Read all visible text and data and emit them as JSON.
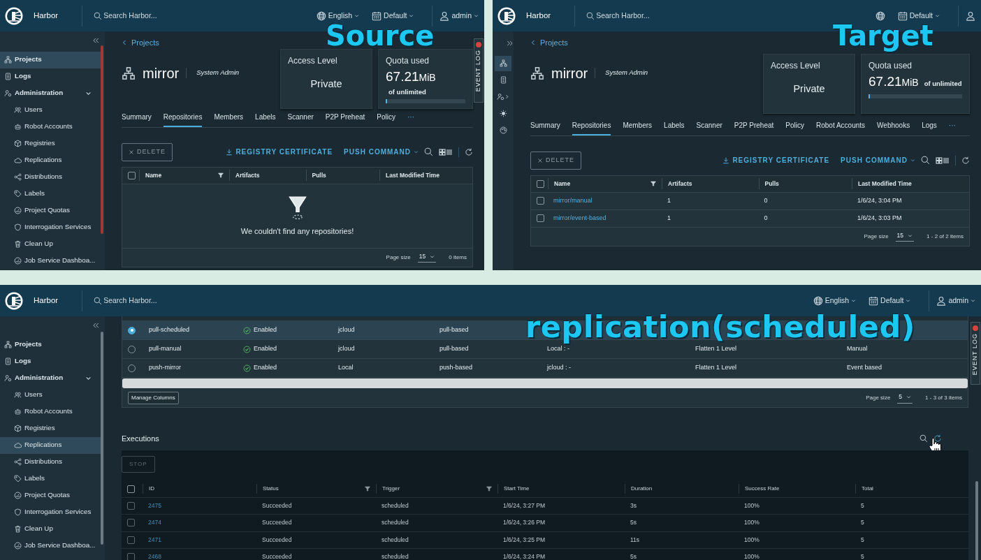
{
  "source": {
    "caption": "Source",
    "header": {
      "brand": "Harbor",
      "search_placeholder": "Search Harbor...",
      "language": "English",
      "theme": "Default",
      "user": "admin"
    },
    "sidebar": {
      "collapsed": false,
      "items": [
        {
          "label": "Projects",
          "selected": true
        },
        {
          "label": "Logs",
          "selected": false
        },
        {
          "label": "Administration",
          "selected": false,
          "expanded": true,
          "children": [
            {
              "label": "Users",
              "selected": false
            },
            {
              "label": "Robot Accounts",
              "selected": false
            },
            {
              "label": "Registries",
              "selected": false
            },
            {
              "label": "Replications",
              "selected": false
            },
            {
              "label": "Distributions",
              "selected": false
            },
            {
              "label": "Labels",
              "selected": false
            },
            {
              "label": "Project Quotas",
              "selected": false
            },
            {
              "label": "Interrogation Services",
              "selected": false
            },
            {
              "label": "Clean Up",
              "selected": false
            },
            {
              "label": "Job Service Dashboa...",
              "selected": false
            }
          ]
        }
      ]
    },
    "event_log": "EVENT LOG",
    "project": {
      "back_link": "Projects",
      "name": "mirror",
      "role": "System Admin",
      "access_card": {
        "title": "Access Level",
        "value": "Private"
      },
      "quota_card": {
        "title": "Quota used",
        "value": "67.21",
        "unit": "MiB",
        "note": "of unlimited",
        "level": 0
      },
      "tabs": [
        {
          "label": "Summary",
          "selected": false
        },
        {
          "label": "Repositories",
          "selected": true
        },
        {
          "label": "Members",
          "selected": false
        },
        {
          "label": "Labels",
          "selected": false
        },
        {
          "label": "Scanner",
          "selected": false
        },
        {
          "label": "P2P Preheat",
          "selected": false
        },
        {
          "label": "Policy",
          "selected": false
        }
      ],
      "more": "···",
      "toolbar": {
        "delete": "DELETE",
        "certificate": "REGISTRY CERTIFICATE",
        "push_command": "PUSH COMMAND"
      },
      "table": {
        "columns": [
          {
            "label": "Name",
            "filter": true
          },
          {
            "label": "Artifacts",
            "filter": false
          },
          {
            "label": "Pulls",
            "filter": false
          },
          {
            "label": "Last Modified Time",
            "filter": false
          }
        ],
        "select_all_checked": false,
        "empty_message": "We couldn't find any repositories!",
        "page_size_label": "Page size",
        "page_size": "15",
        "count": "0 items"
      }
    }
  },
  "target": {
    "caption": "Target",
    "header": {
      "brand": "Harbor",
      "search_placeholder": "Search Harbor...",
      "theme": "Default"
    },
    "sidebar": {
      "collapsed": true,
      "items": [
        {
          "selected": true
        },
        {
          "selected": false
        },
        {
          "selected": false,
          "expanded": false
        },
        {
          "selected": false
        },
        {
          "selected": false
        }
      ]
    },
    "project": {
      "back_link": "Projects",
      "name": "mirror",
      "role": "System Admin",
      "access_card": {
        "title": "Access Level",
        "value": "Private"
      },
      "quota_card": {
        "title": "Quota used",
        "value": "67.21",
        "unit": "MiB",
        "note": "of unlimited",
        "level": 0
      },
      "tabs": [
        {
          "label": "Summary",
          "selected": false
        },
        {
          "label": "Repositories",
          "selected": true
        },
        {
          "label": "Members",
          "selected": false
        },
        {
          "label": "Labels",
          "selected": false
        },
        {
          "label": "Scanner",
          "selected": false
        },
        {
          "label": "P2P Preheat",
          "selected": false
        },
        {
          "label": "Policy",
          "selected": false
        },
        {
          "label": "Robot Accounts",
          "selected": false
        },
        {
          "label": "Webhooks",
          "selected": false
        },
        {
          "label": "Logs",
          "selected": false
        }
      ],
      "more": "···",
      "toolbar": {
        "delete": "DELETE",
        "certificate": "REGISTRY CERTIFICATE",
        "push_command": "PUSH COMMAND"
      },
      "table": {
        "columns": [
          {
            "label": "Name",
            "filter": true
          },
          {
            "label": "Artifacts",
            "filter": false
          },
          {
            "label": "Pulls",
            "filter": false
          },
          {
            "label": "Last Modified Time",
            "filter": false
          }
        ],
        "select_all_checked": false,
        "rows": [
          {
            "name": "mirror/manual",
            "artifacts": "1",
            "pulls": "0",
            "modified": "1/6/24, 3:04 PM",
            "checked": false
          },
          {
            "name": "mirror/event-based",
            "artifacts": "1",
            "pulls": "0",
            "modified": "1/6/24, 3:03 PM",
            "checked": false
          }
        ],
        "page_size_label": "Page size",
        "page_size": "15",
        "count": "1 - 2 of 2 items"
      }
    }
  },
  "replication": {
    "caption": "replication(scheduled)",
    "header": {
      "brand": "Harbor",
      "search_placeholder": "Search Harbor...",
      "language": "English",
      "theme": "Default",
      "user": "admin"
    },
    "sidebar": {
      "collapsed": false,
      "items": [
        {
          "label": "Projects",
          "selected": false
        },
        {
          "label": "Logs",
          "selected": false
        },
        {
          "label": "Administration",
          "selected": false,
          "expanded": true,
          "children": [
            {
              "label": "Users",
              "selected": false
            },
            {
              "label": "Robot Accounts",
              "selected": false
            },
            {
              "label": "Registries",
              "selected": false
            },
            {
              "label": "Replications",
              "selected": true
            },
            {
              "label": "Distributions",
              "selected": false
            },
            {
              "label": "Labels",
              "selected": false
            },
            {
              "label": "Project Quotas",
              "selected": false
            },
            {
              "label": "Interrogation Services",
              "selected": false
            },
            {
              "label": "Clean Up",
              "selected": false
            },
            {
              "label": "Job Service Dashboa...",
              "selected": false
            }
          ]
        }
      ]
    },
    "rules": {
      "rows": [
        {
          "name": "pull-scheduled",
          "status": "Enabled",
          "source": "jcloud",
          "mode": "pull-based",
          "selected": true
        },
        {
          "name": "pull-manual",
          "status": "Enabled",
          "source": "jcloud",
          "mode": "pull-based",
          "destination": "Local : -",
          "flattening": "Flatten 1 Level",
          "trigger": "Manual",
          "selected": false
        },
        {
          "name": "push-mirror",
          "status": "Enabled",
          "source": "Local",
          "mode": "push-based",
          "destination": "jcloud : -",
          "flattening": "Flatten 1 Level",
          "trigger": "Event based",
          "selected": false
        }
      ],
      "manage_columns": "Manage Columns",
      "page_size_label": "Page size",
      "page_size": "5",
      "count": "1 - 3 of 3 items"
    },
    "executions": {
      "title": "Executions",
      "stop": "STOP",
      "select_all_checked": false,
      "columns": [
        {
          "label": "ID",
          "filter": false
        },
        {
          "label": "Status",
          "filter": true
        },
        {
          "label": "Trigger",
          "filter": true
        },
        {
          "label": "Start Time",
          "filter": false
        },
        {
          "label": "Duration",
          "filter": false
        },
        {
          "label": "Success Rate",
          "filter": false
        },
        {
          "label": "Total",
          "filter": false
        }
      ],
      "rows": [
        {
          "id": "2475",
          "status": "Succeeded",
          "trigger": "scheduled",
          "start": "1/6/24, 3:27 PM",
          "duration": "3s",
          "rate": "100%",
          "total": "5",
          "checked": false
        },
        {
          "id": "2474",
          "status": "Succeeded",
          "trigger": "scheduled",
          "start": "1/6/24, 3:26 PM",
          "duration": "5s",
          "rate": "100%",
          "total": "5",
          "checked": false
        },
        {
          "id": "2471",
          "status": "Succeeded",
          "trigger": "scheduled",
          "start": "1/6/24, 3:25 PM",
          "duration": "11s",
          "rate": "100%",
          "total": "5",
          "checked": false
        },
        {
          "id": "2468",
          "status": "Succeeded",
          "trigger": "scheduled",
          "start": "1/6/24, 3:24 PM",
          "duration": "5s",
          "rate": "100%",
          "total": "5",
          "checked": false
        }
      ]
    },
    "event_log": "EVENT LOG"
  }
}
